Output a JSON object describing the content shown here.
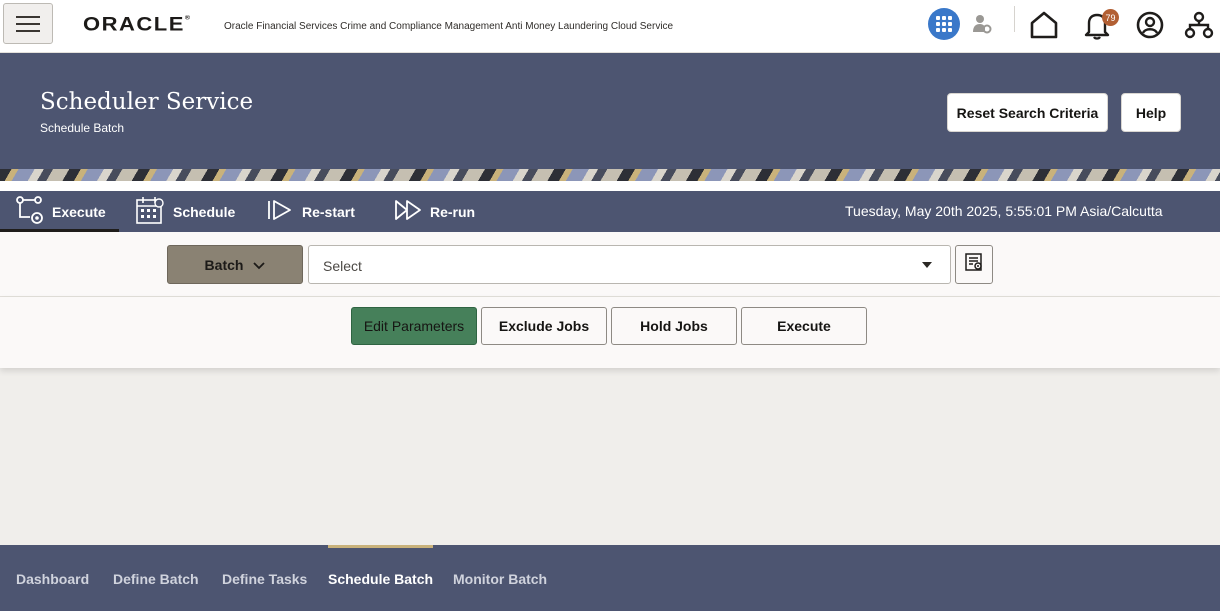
{
  "header": {
    "logo_text": "ORACLE",
    "logo_mark": "®",
    "product_name": "Oracle Financial Services Crime and Compliance Management Anti Money Laundering Cloud Service",
    "notification_count": "79",
    "icons": [
      "hamburger-menu-icon",
      "apps-grid-icon",
      "user-settings-icon",
      "home-icon",
      "bell-icon",
      "user-profile-icon",
      "sitemap-icon"
    ]
  },
  "page": {
    "title": "Scheduler Service",
    "subtitle": "Schedule Batch",
    "reset_button": "Reset Search Criteria",
    "help_button": "Help"
  },
  "tabs": {
    "items": [
      {
        "label": "Execute",
        "icon": "execute-flow-icon",
        "active": true
      },
      {
        "label": "Schedule",
        "icon": "calendar-icon",
        "active": false
      },
      {
        "label": "Re-start",
        "icon": "restart-icon",
        "active": false
      },
      {
        "label": "Re-run",
        "icon": "rerun-icon",
        "active": false
      }
    ],
    "datetime": "Tuesday, May 20th 2025, 5:55:01 PM Asia/Calcutta"
  },
  "selector": {
    "type_button": "Batch",
    "select_placeholder": "Select"
  },
  "actions": {
    "edit_parameters": "Edit Parameters",
    "exclude_jobs": "Exclude Jobs",
    "hold_jobs": "Hold Jobs",
    "execute": "Execute"
  },
  "footer": {
    "items": [
      {
        "label": "Dashboard",
        "active": false
      },
      {
        "label": "Define Batch",
        "active": false
      },
      {
        "label": "Define Tasks",
        "active": false
      },
      {
        "label": "Schedule Batch",
        "active": true
      },
      {
        "label": "Monitor Batch",
        "active": false
      }
    ]
  },
  "colors": {
    "banner": "#4d5571",
    "primary_button": "#46805a",
    "batch_button": "#8a8273",
    "apps_button": "#3a78c9",
    "badge": "#b25f33",
    "footer_active_underline": "#c9b27b"
  }
}
